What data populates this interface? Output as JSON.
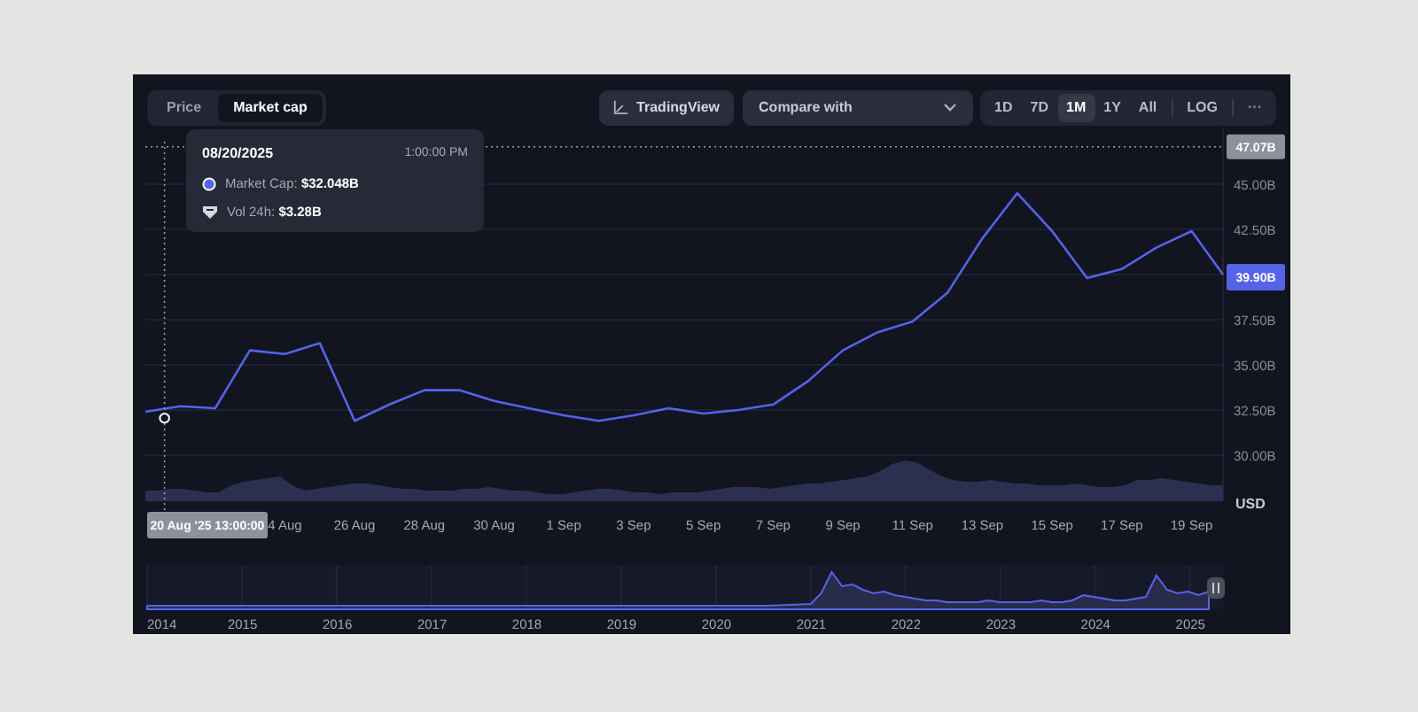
{
  "tabs": [
    {
      "label": "Price",
      "selected": false
    },
    {
      "label": "Market cap",
      "selected": true
    }
  ],
  "toolbar": {
    "tradingview_button": "TradingView",
    "compare": {
      "placeholder": "Compare with"
    },
    "ranges": [
      {
        "label": "1D",
        "selected": false
      },
      {
        "label": "7D",
        "selected": false
      },
      {
        "label": "1M",
        "selected": true
      },
      {
        "label": "1Y",
        "selected": false
      },
      {
        "label": "All",
        "selected": false
      }
    ],
    "log_button": "LOG",
    "more_button": "···"
  },
  "tooltip": {
    "date": "08/20/2025",
    "time": "1:00:00 PM",
    "rows": [
      {
        "kind": "market_cap",
        "text": "Market Cap: **$32.048B**"
      },
      {
        "kind": "volume",
        "text": "Vol 24h: **$3.28B**"
      }
    ]
  },
  "chart": {
    "chart_data": {
      "type": "line",
      "categories": [
        null,
        null,
        null,
        null,
        "4 Aug",
        null,
        "26 Aug",
        null,
        "28 Aug",
        null,
        "30 Aug",
        null,
        "1 Sep",
        null,
        "3 Sep",
        null,
        "5 Sep",
        null,
        "7 Sep",
        null,
        "9 Sep",
        null,
        "11 Sep",
        null,
        "13 Sep",
        null,
        "15 Sep",
        null,
        "17 Sep",
        null,
        "19 Sep",
        null
      ],
      "series": [
        {
          "color": "#5563e8",
          "values": [
            32.4,
            32.7,
            32.6,
            35.8,
            35.6,
            36.2,
            31.9,
            32.8,
            33.6,
            33.6,
            33.0,
            32.6,
            32.2,
            31.9,
            32.2,
            32.6,
            32.3,
            32.5,
            32.8,
            34.1,
            35.8,
            36.8,
            37.4,
            39.0,
            42.0,
            44.5,
            42.4,
            39.8,
            40.3,
            41.5,
            42.4,
            40.0
          ]
        }
      ],
      "ylim": [
        27.45,
        47.35
      ],
      "grid": true,
      "ref_lines": [
        {
          "axis": "y",
          "value": 47.07,
          "label": "47.07B"
        }
      ],
      "yticks": [
        {
          "value": 45,
          "label": "45.00B"
        },
        {
          "value": 42.5,
          "label": "42.50B"
        },
        {
          "value": 37.5,
          "label": "37.50B"
        },
        {
          "value": 35,
          "label": "35.00B"
        },
        {
          "value": 32.5,
          "label": "32.50B"
        },
        {
          "value": 30,
          "label": "30.00B"
        }
      ]
    },
    "crosshair": {
      "date_label": "20 Aug '25 13:00:00"
    },
    "last_value_label": "39.90B",
    "currency": "USD"
  },
  "navigator": {
    "years": [
      "2014",
      "2015",
      "2016",
      "2017",
      "2018",
      "2019",
      "2020",
      "2021",
      "2022",
      "2023",
      "2024",
      "2025"
    ]
  }
}
